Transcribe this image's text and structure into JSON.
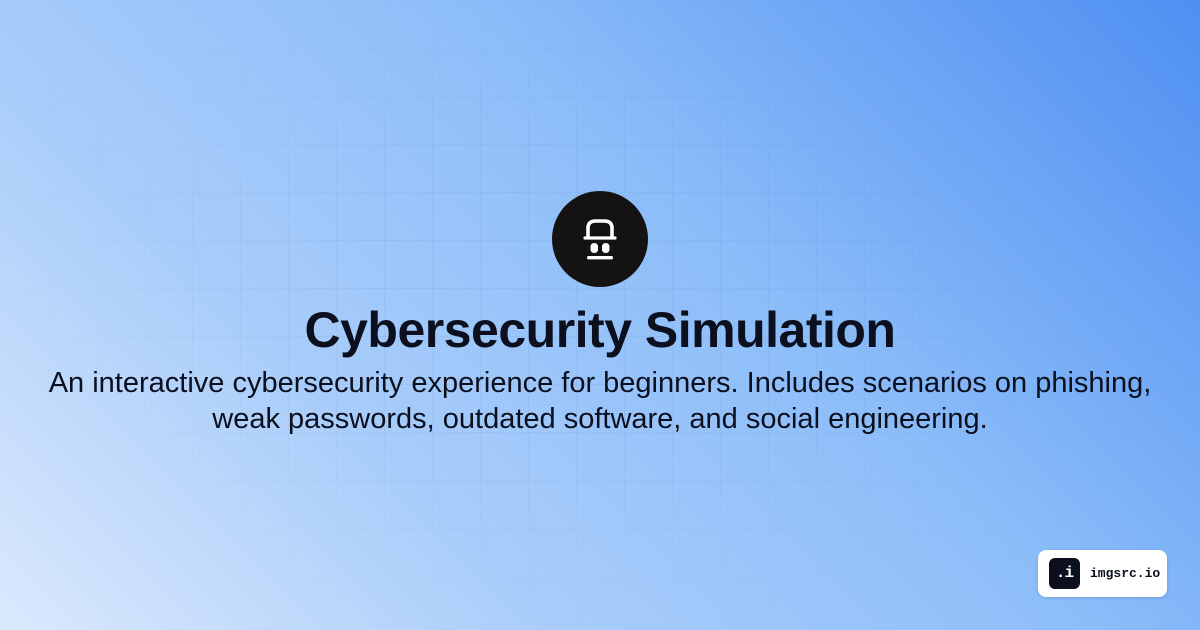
{
  "page": {
    "title": "Cybersecurity Simulation",
    "description": "An interactive cybersecurity experience for beginners. Includes scenarios on phishing, weak passwords, outdated software, and social engineering.",
    "logo_icon": "lock-robot-icon"
  },
  "badge": {
    "icon_glyph": ".i",
    "label": "imgsrc.io"
  },
  "colors": {
    "text": "#0b0f1e",
    "logo_background": "#141212",
    "gradient_light": "#dbe9fd",
    "gradient_dark": "#4f8ff2"
  }
}
